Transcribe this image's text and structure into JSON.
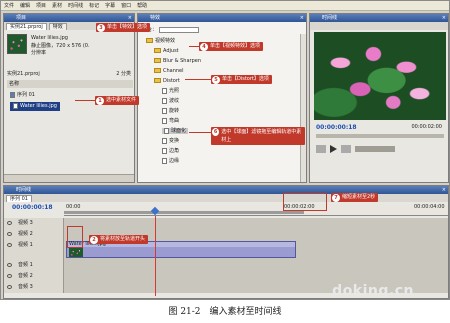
{
  "menu": [
    "文件",
    "编辑",
    "项目",
    "素材",
    "时间线",
    "标记",
    "字幕",
    "窗口",
    "帮助"
  ],
  "project_panel": {
    "title": "项目",
    "tabs": [
      "实例21.prproj",
      "特效"
    ],
    "preview_name": "Water lilies.jpg",
    "preview_info": "静止图像，720 x 576 (0.",
    "preview_info2": "分辨率",
    "project_file": "实例21.prproj",
    "item_count": "2 分类",
    "col_name": "名称",
    "items": [
      {
        "label": "序列 01",
        "icon": "sequence-icon"
      },
      {
        "label": "Water lilies.jpg",
        "icon": "file-icon"
      }
    ]
  },
  "effects_panel": {
    "title": "特效",
    "search_label": "包含：",
    "folders": [
      "视频特效",
      "Adjust",
      "Blur & Sharpen",
      "Channel",
      "Distort"
    ],
    "items": [
      "光照",
      "波纹",
      "旋转",
      "弯曲",
      "镜像",
      "变换",
      "边角",
      "边缘",
      "球面化",
      "弯曲",
      "扭曲"
    ],
    "selected_item": "球面化"
  },
  "monitor": {
    "title": "时间线",
    "timecode_left": "00:00:00:18",
    "timecode_right": "00:00:02:00"
  },
  "timeline": {
    "title": "时间线",
    "sequence": "序列 01",
    "timecode": "00:00:00:18",
    "ruler_labels": [
      "00:00",
      "00:00:02:00",
      "00:00:04:00"
    ],
    "tracks": [
      "视频 3",
      "视频 2",
      "视频 1",
      "音频 1",
      "音频 2",
      "音频 3"
    ],
    "clip_name": "Water lilies.jpg"
  },
  "callouts": [
    {
      "num": "1",
      "text": "选中素材文件"
    },
    {
      "num": "2",
      "text": "将素材放至轨道开头"
    },
    {
      "num": "3",
      "text": "单击【特效】选项"
    },
    {
      "num": "4",
      "text": "单击【视频特效】选项"
    },
    {
      "num": "5",
      "text": "单击【Distort】选项"
    },
    {
      "num": "6",
      "text": "选中【球面】滤镜拖至编辑轨道中素材上"
    },
    {
      "num": "7",
      "text": "缩短素材至2秒"
    }
  ],
  "caption": "图 21-2　编入素材至时间线",
  "watermark": "doking.cn"
}
